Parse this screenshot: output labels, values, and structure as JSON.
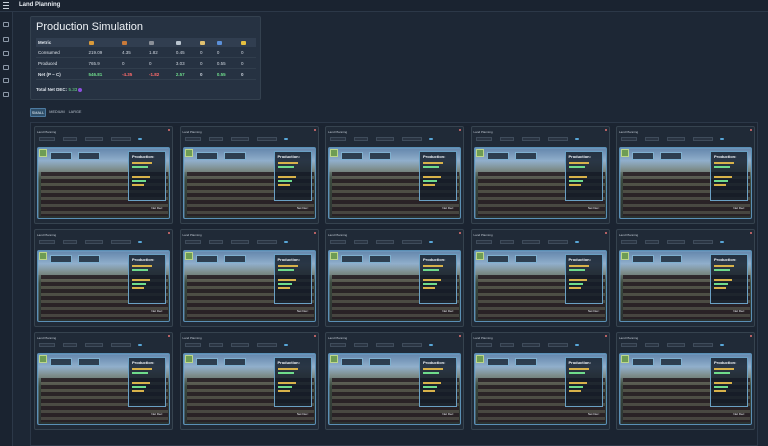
{
  "app": {
    "title": "Land Planning"
  },
  "sidebar": {
    "icons": [
      "home-icon",
      "layers-icon",
      "map-icon",
      "chart-icon",
      "users-icon",
      "calendar-icon"
    ]
  },
  "simulation": {
    "title": "Production Simulation",
    "columns": [
      "Metric",
      "",
      "",
      "",
      "",
      "",
      "",
      ""
    ],
    "rows": [
      {
        "label": "Consumed",
        "values": [
          "219.09",
          "4.35",
          "1.82",
          "0.45",
          "0",
          "0",
          "0"
        ]
      },
      {
        "label": "Produced",
        "values": [
          "765.9",
          "0",
          "0",
          "3.03",
          "0",
          "0.55",
          "0"
        ]
      },
      {
        "label": "Net (P − C)",
        "values": [
          "546.81",
          "-4.35",
          "-1.82",
          "2.57",
          "0",
          "0.55",
          "0"
        ]
      }
    ],
    "total_label": "Total Net DEC:",
    "total_value": "5.33"
  },
  "size_tabs": [
    {
      "label": "SMALL",
      "active": true
    },
    {
      "label": "MEDIUM",
      "active": false
    },
    {
      "label": "LARGE",
      "active": false
    }
  ],
  "cards": {
    "header": "Land Planning",
    "screen_title": "Production:",
    "net_label": "Net Dec:"
  },
  "colors": {
    "positive": "#6fdc8c",
    "negative": "#ff6b6b",
    "accent": "#5a8fb5"
  }
}
